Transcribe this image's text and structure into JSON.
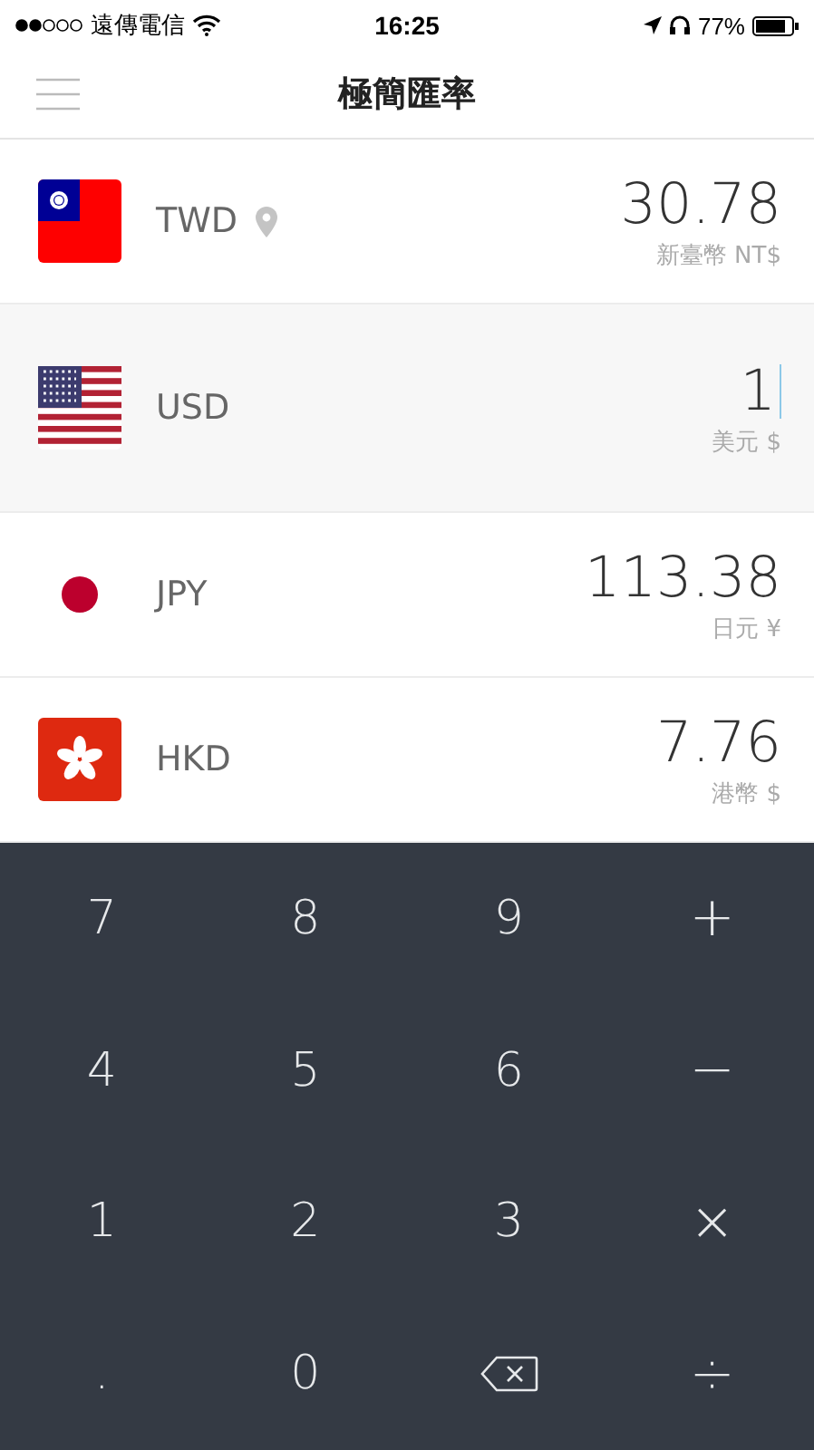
{
  "status_bar": {
    "carrier": "遠傳電信",
    "time": "16:25",
    "battery": "77%"
  },
  "nav": {
    "title": "極簡匯率"
  },
  "currencies": [
    {
      "code": "TWD",
      "kind": "tw",
      "location": true,
      "amount": "30.78",
      "name": "新臺幣 NT$",
      "selected": false
    },
    {
      "code": "USD",
      "kind": "us",
      "location": false,
      "amount": "1",
      "name": "美元 $",
      "selected": true
    },
    {
      "code": "JPY",
      "kind": "jp",
      "location": false,
      "amount": "113.38",
      "name": "日元 ¥",
      "selected": false
    },
    {
      "code": "HKD",
      "kind": "hk",
      "location": false,
      "amount": "7.76",
      "name": "港幣 $",
      "selected": false
    }
  ],
  "keypad": [
    {
      "kind": "digit",
      "label": "7"
    },
    {
      "kind": "digit",
      "label": "8"
    },
    {
      "kind": "digit",
      "label": "9"
    },
    {
      "kind": "op",
      "label": "+"
    },
    {
      "kind": "digit",
      "label": "4"
    },
    {
      "kind": "digit",
      "label": "5"
    },
    {
      "kind": "digit",
      "label": "6"
    },
    {
      "kind": "op",
      "label": "−"
    },
    {
      "kind": "digit",
      "label": "1"
    },
    {
      "kind": "digit",
      "label": "2"
    },
    {
      "kind": "digit",
      "label": "3"
    },
    {
      "kind": "op",
      "label": "×"
    },
    {
      "kind": "digit",
      "label": "."
    },
    {
      "kind": "digit",
      "label": "0"
    },
    {
      "kind": "backspace"
    },
    {
      "kind": "op",
      "label": "÷"
    }
  ]
}
